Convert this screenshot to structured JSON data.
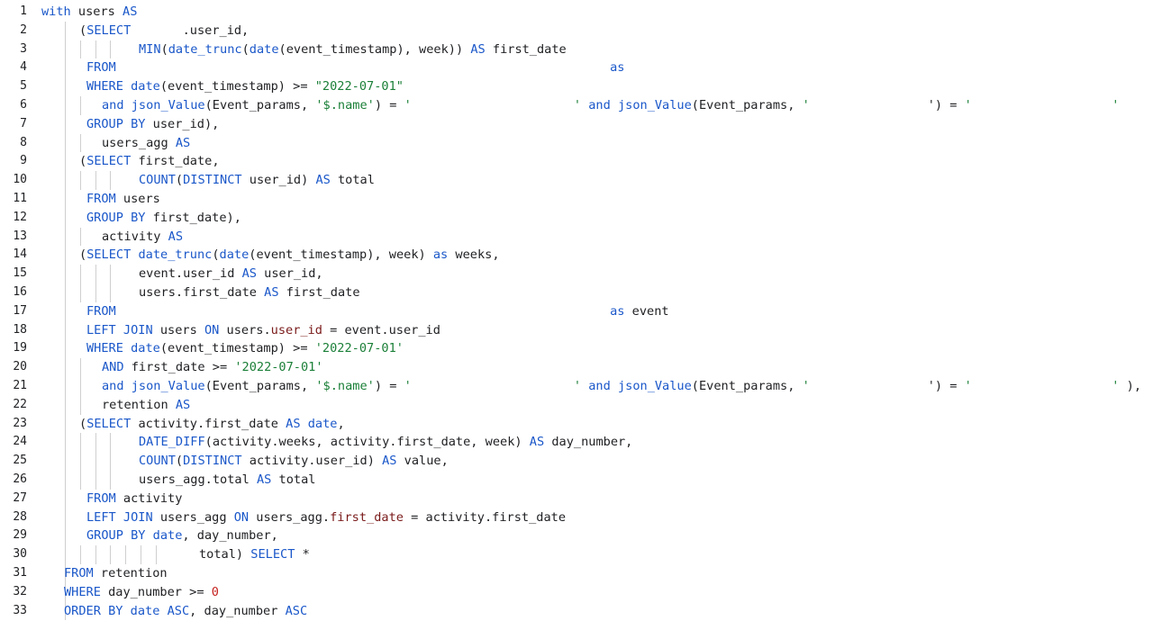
{
  "editor": {
    "line_numbers": [
      "1",
      "2",
      "3",
      "4",
      "5",
      "6",
      "7",
      "8",
      "9",
      "10",
      "11",
      "12",
      "13",
      "14",
      "15",
      "16",
      "17",
      "18",
      "19",
      "20",
      "21",
      "22",
      "23",
      "24",
      "25",
      "26",
      "27",
      "28",
      "29",
      "30",
      "31",
      "32",
      "33"
    ],
    "lines": [
      {
        "indent": 0,
        "guides": 0,
        "tokens": [
          {
            "t": "with",
            "c": "kw"
          },
          {
            "t": " users ",
            "c": "plain"
          },
          {
            "t": "AS",
            "c": "kw"
          }
        ]
      },
      {
        "indent": 42,
        "guides": 1,
        "tokens": [
          {
            "t": "(",
            "c": "plain"
          },
          {
            "t": "SELECT",
            "c": "kw"
          },
          {
            "t": "       .user_id,",
            "c": "plain"
          }
        ]
      },
      {
        "indent": 108,
        "guides": 4,
        "tokens": [
          {
            "t": "MIN",
            "c": "fn"
          },
          {
            "t": "(",
            "c": "plain"
          },
          {
            "t": "date_trunc",
            "c": "fn"
          },
          {
            "t": "(",
            "c": "plain"
          },
          {
            "t": "date",
            "c": "fn"
          },
          {
            "t": "(event_timestamp), week)) ",
            "c": "plain"
          },
          {
            "t": "AS",
            "c": "kw"
          },
          {
            "t": " first_date",
            "c": "plain"
          }
        ]
      },
      {
        "indent": 50,
        "guides": 1,
        "tokens": [
          {
            "t": "FROM",
            "c": "kw"
          },
          {
            "t": "                                                                   ",
            "c": "plain"
          },
          {
            "t": "as",
            "c": "kw"
          }
        ]
      },
      {
        "indent": 50,
        "guides": 1,
        "tokens": [
          {
            "t": "WHERE",
            "c": "kw"
          },
          {
            "t": " ",
            "c": "plain"
          },
          {
            "t": "date",
            "c": "fn"
          },
          {
            "t": "(event_timestamp) >= ",
            "c": "plain"
          },
          {
            "t": "\"2022-07-01\"",
            "c": "str"
          }
        ]
      },
      {
        "indent": 67,
        "guides": 2,
        "tokens": [
          {
            "t": "and",
            "c": "kw"
          },
          {
            "t": " ",
            "c": "plain"
          },
          {
            "t": "json_Value",
            "c": "fn"
          },
          {
            "t": "(Event_params, ",
            "c": "plain"
          },
          {
            "t": "'$.name'",
            "c": "str"
          },
          {
            "t": ") = ",
            "c": "plain"
          },
          {
            "t": "'                      '",
            "c": "str"
          },
          {
            "t": " ",
            "c": "plain"
          },
          {
            "t": "and",
            "c": "kw"
          },
          {
            "t": " ",
            "c": "plain"
          },
          {
            "t": "json_Value",
            "c": "fn"
          },
          {
            "t": "(Event_params, ",
            "c": "plain"
          },
          {
            "t": "'                ",
            "c": "str"
          },
          {
            "t": "') = ",
            "c": "plain"
          },
          {
            "t": "'                   '",
            "c": "str"
          }
        ]
      },
      {
        "indent": 50,
        "guides": 1,
        "tokens": [
          {
            "t": "GROUP BY",
            "c": "kw"
          },
          {
            "t": " user_id),",
            "c": "plain"
          }
        ]
      },
      {
        "indent": 67,
        "guides": 2,
        "tokens": [
          {
            "t": "users_agg ",
            "c": "plain"
          },
          {
            "t": "AS",
            "c": "kw"
          }
        ]
      },
      {
        "indent": 42,
        "guides": 1,
        "tokens": [
          {
            "t": "(",
            "c": "plain"
          },
          {
            "t": "SELECT",
            "c": "kw"
          },
          {
            "t": " first_date,",
            "c": "plain"
          }
        ]
      },
      {
        "indent": 108,
        "guides": 4,
        "tokens": [
          {
            "t": "COUNT",
            "c": "fn"
          },
          {
            "t": "(",
            "c": "plain"
          },
          {
            "t": "DISTINCT",
            "c": "kw"
          },
          {
            "t": " user_id) ",
            "c": "plain"
          },
          {
            "t": "AS",
            "c": "kw"
          },
          {
            "t": " total",
            "c": "plain"
          }
        ]
      },
      {
        "indent": 50,
        "guides": 1,
        "tokens": [
          {
            "t": "FROM",
            "c": "kw"
          },
          {
            "t": " users",
            "c": "plain"
          }
        ]
      },
      {
        "indent": 50,
        "guides": 1,
        "tokens": [
          {
            "t": "GROUP BY",
            "c": "kw"
          },
          {
            "t": " first_date),",
            "c": "plain"
          }
        ]
      },
      {
        "indent": 67,
        "guides": 2,
        "tokens": [
          {
            "t": "activity ",
            "c": "plain"
          },
          {
            "t": "AS",
            "c": "kw"
          }
        ]
      },
      {
        "indent": 42,
        "guides": 1,
        "tokens": [
          {
            "t": "(",
            "c": "plain"
          },
          {
            "t": "SELECT",
            "c": "kw"
          },
          {
            "t": " ",
            "c": "plain"
          },
          {
            "t": "date_trunc",
            "c": "fn"
          },
          {
            "t": "(",
            "c": "plain"
          },
          {
            "t": "date",
            "c": "fn"
          },
          {
            "t": "(event_timestamp), week) ",
            "c": "plain"
          },
          {
            "t": "as",
            "c": "kw"
          },
          {
            "t": " weeks,",
            "c": "plain"
          }
        ]
      },
      {
        "indent": 108,
        "guides": 4,
        "tokens": [
          {
            "t": "event.user_id ",
            "c": "plain"
          },
          {
            "t": "AS",
            "c": "kw"
          },
          {
            "t": " user_id,",
            "c": "plain"
          }
        ]
      },
      {
        "indent": 108,
        "guides": 4,
        "tokens": [
          {
            "t": "users.first_date ",
            "c": "plain"
          },
          {
            "t": "AS",
            "c": "kw"
          },
          {
            "t": " first_date",
            "c": "plain"
          }
        ]
      },
      {
        "indent": 50,
        "guides": 1,
        "tokens": [
          {
            "t": "FROM",
            "c": "kw"
          },
          {
            "t": "                                                                   ",
            "c": "plain"
          },
          {
            "t": "as",
            "c": "kw"
          },
          {
            "t": " event",
            "c": "plain"
          }
        ]
      },
      {
        "indent": 50,
        "guides": 1,
        "tokens": [
          {
            "t": "LEFT JOIN",
            "c": "kw"
          },
          {
            "t": " users ",
            "c": "plain"
          },
          {
            "t": "ON",
            "c": "kw"
          },
          {
            "t": " users.",
            "c": "plain"
          },
          {
            "t": "user_id",
            "c": "col"
          },
          {
            "t": " = event.user_id",
            "c": "plain"
          }
        ]
      },
      {
        "indent": 50,
        "guides": 1,
        "tokens": [
          {
            "t": "WHERE",
            "c": "kw"
          },
          {
            "t": " ",
            "c": "plain"
          },
          {
            "t": "date",
            "c": "fn"
          },
          {
            "t": "(event_timestamp) >= ",
            "c": "plain"
          },
          {
            "t": "'2022-07-01'",
            "c": "str"
          }
        ]
      },
      {
        "indent": 67,
        "guides": 2,
        "tokens": [
          {
            "t": "AND",
            "c": "kw"
          },
          {
            "t": " first_date >= ",
            "c": "plain"
          },
          {
            "t": "'2022-07-01'",
            "c": "str"
          }
        ]
      },
      {
        "indent": 67,
        "guides": 2,
        "tokens": [
          {
            "t": "and",
            "c": "kw"
          },
          {
            "t": " ",
            "c": "plain"
          },
          {
            "t": "json_Value",
            "c": "fn"
          },
          {
            "t": "(Event_params, ",
            "c": "plain"
          },
          {
            "t": "'$.name'",
            "c": "str"
          },
          {
            "t": ") = ",
            "c": "plain"
          },
          {
            "t": "'                      '",
            "c": "str"
          },
          {
            "t": " ",
            "c": "plain"
          },
          {
            "t": "and",
            "c": "kw"
          },
          {
            "t": " ",
            "c": "plain"
          },
          {
            "t": "json_Value",
            "c": "fn"
          },
          {
            "t": "(Event_params, ",
            "c": "plain"
          },
          {
            "t": "'                ",
            "c": "str"
          },
          {
            "t": "') = ",
            "c": "plain"
          },
          {
            "t": "'                   '",
            "c": "str"
          },
          {
            "t": " ),",
            "c": "plain"
          }
        ]
      },
      {
        "indent": 67,
        "guides": 2,
        "tokens": [
          {
            "t": "retention ",
            "c": "plain"
          },
          {
            "t": "AS",
            "c": "kw"
          }
        ]
      },
      {
        "indent": 42,
        "guides": 1,
        "tokens": [
          {
            "t": "(",
            "c": "plain"
          },
          {
            "t": "SELECT",
            "c": "kw"
          },
          {
            "t": " activity.first_date ",
            "c": "plain"
          },
          {
            "t": "AS",
            "c": "kw"
          },
          {
            "t": " ",
            "c": "plain"
          },
          {
            "t": "date",
            "c": "fn"
          },
          {
            "t": ",",
            "c": "plain"
          }
        ]
      },
      {
        "indent": 108,
        "guides": 4,
        "tokens": [
          {
            "t": "DATE_DIFF",
            "c": "fn"
          },
          {
            "t": "(activity.weeks, activity.first_date, week) ",
            "c": "plain"
          },
          {
            "t": "AS",
            "c": "kw"
          },
          {
            "t": " day_number,",
            "c": "plain"
          }
        ]
      },
      {
        "indent": 108,
        "guides": 4,
        "tokens": [
          {
            "t": "COUNT",
            "c": "fn"
          },
          {
            "t": "(",
            "c": "plain"
          },
          {
            "t": "DISTINCT",
            "c": "kw"
          },
          {
            "t": " activity.user_id) ",
            "c": "plain"
          },
          {
            "t": "AS",
            "c": "kw"
          },
          {
            "t": " value,",
            "c": "plain"
          }
        ]
      },
      {
        "indent": 108,
        "guides": 4,
        "tokens": [
          {
            "t": "users_agg.total ",
            "c": "plain"
          },
          {
            "t": "AS",
            "c": "kw"
          },
          {
            "t": " total",
            "c": "plain"
          }
        ]
      },
      {
        "indent": 50,
        "guides": 1,
        "tokens": [
          {
            "t": "FROM",
            "c": "kw"
          },
          {
            "t": " activity",
            "c": "plain"
          }
        ]
      },
      {
        "indent": 50,
        "guides": 1,
        "tokens": [
          {
            "t": "LEFT JOIN",
            "c": "kw"
          },
          {
            "t": " users_agg ",
            "c": "plain"
          },
          {
            "t": "ON",
            "c": "kw"
          },
          {
            "t": " users_agg.",
            "c": "plain"
          },
          {
            "t": "first_date",
            "c": "col"
          },
          {
            "t": " = activity.first_date",
            "c": "plain"
          }
        ]
      },
      {
        "indent": 50,
        "guides": 1,
        "tokens": [
          {
            "t": "GROUP BY",
            "c": "kw"
          },
          {
            "t": " ",
            "c": "plain"
          },
          {
            "t": "date",
            "c": "fn"
          },
          {
            "t": ", day_number,",
            "c": "plain"
          }
        ]
      },
      {
        "indent": 175,
        "guides": 7,
        "tokens": [
          {
            "t": "total) ",
            "c": "plain"
          },
          {
            "t": "SELECT",
            "c": "kw"
          },
          {
            "t": " *",
            "c": "plain"
          }
        ]
      },
      {
        "indent": 25,
        "guides": 1,
        "tokens": [
          {
            "t": "FROM",
            "c": "kw"
          },
          {
            "t": " retention",
            "c": "plain"
          }
        ]
      },
      {
        "indent": 25,
        "guides": 1,
        "tokens": [
          {
            "t": "WHERE",
            "c": "kw"
          },
          {
            "t": " day_number >= ",
            "c": "plain"
          },
          {
            "t": "0",
            "c": "num"
          }
        ]
      },
      {
        "indent": 25,
        "guides": 1,
        "tokens": [
          {
            "t": "ORDER BY",
            "c": "kw"
          },
          {
            "t": " ",
            "c": "plain"
          },
          {
            "t": "date",
            "c": "fn"
          },
          {
            "t": " ",
            "c": "plain"
          },
          {
            "t": "ASC",
            "c": "kw"
          },
          {
            "t": ", day_number ",
            "c": "plain"
          },
          {
            "t": "ASC",
            "c": "kw"
          }
        ]
      }
    ]
  },
  "colors": {
    "keyword": "#1a57c9",
    "string": "#1a7f37",
    "number": "#c5221f",
    "text": "#202124",
    "guide": "#cfcfcf",
    "background": "#ffffff"
  }
}
